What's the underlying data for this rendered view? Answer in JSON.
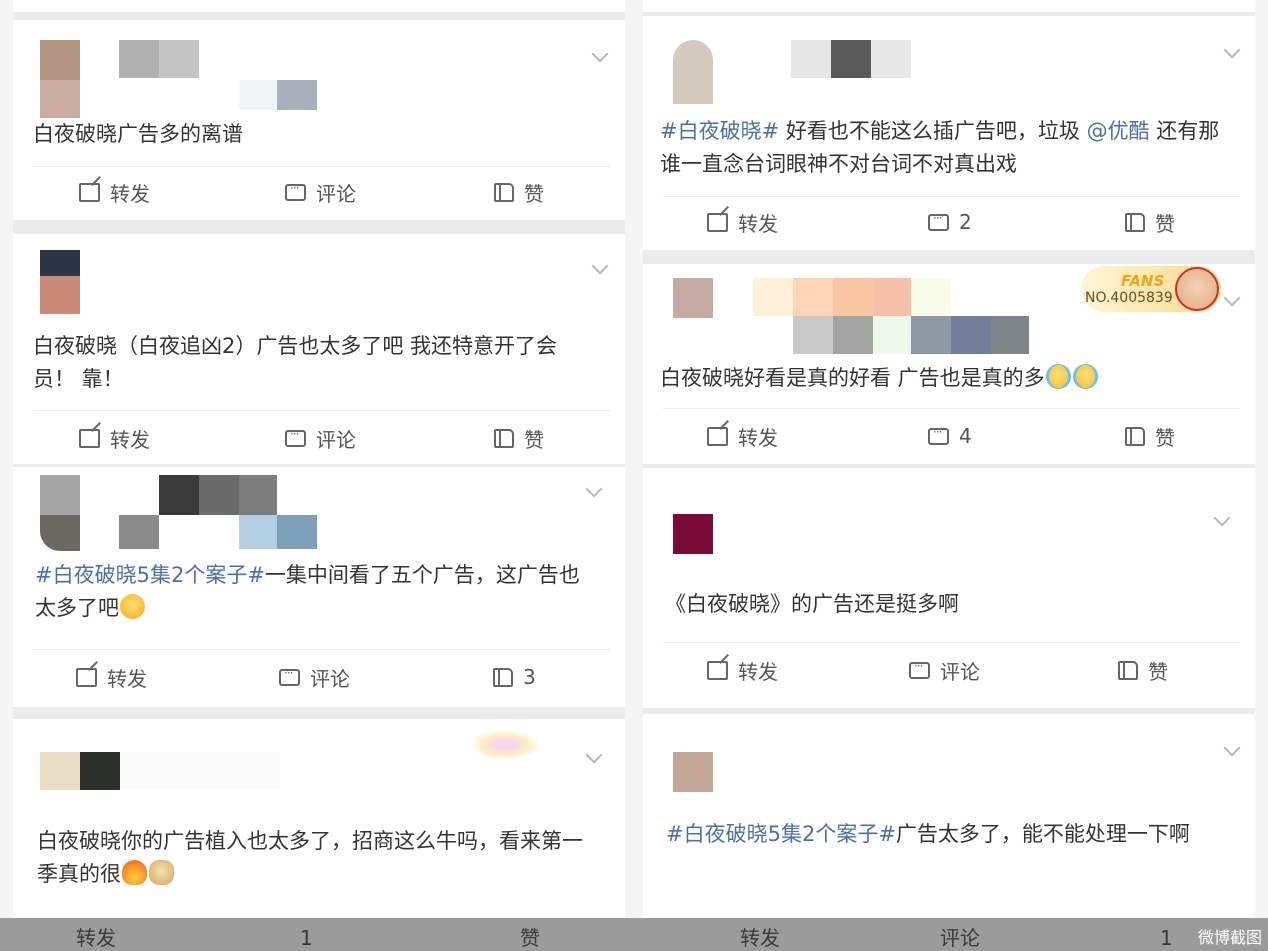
{
  "actions": {
    "repost": "转发",
    "comment": "评论",
    "like": "赞"
  },
  "posts_left": [
    {
      "text": "白夜破晓广告多的离谱",
      "repost": "转发",
      "comment": "评论",
      "like": "赞"
    },
    {
      "text": "白夜破晓（白夜追凶2）广告也太多了吧 我还特意开了会员！ 靠！",
      "repost": "转发",
      "comment": "评论",
      "like": "赞"
    },
    {
      "hashtag": "#白夜破晓5集2个案子#",
      "text": "一集中间看了五个广告，这广告也太多了吧",
      "emoji": "laughing-emoji",
      "repost": "转发",
      "comment": "评论",
      "like": "3"
    },
    {
      "text": "白夜破晓你的广告植入也太多了，招商这么牛吗，看来第一季真的很",
      "emoji": [
        "fire-emoji",
        "doge-emoji"
      ],
      "repost": "转发",
      "comment": "1",
      "like": "赞"
    }
  ],
  "posts_right": [
    {
      "hashtag": "#白夜破晓#",
      "text_a": " 好看也不能这么插广告吧，垃圾 ",
      "mention": "@优酷",
      "text_b": " 还有那谁一直念台词眼神不对台词不对真出戏",
      "repost": "转发",
      "comment": "2",
      "like": "赞"
    },
    {
      "text": "白夜破晓好看是真的好看 广告也是真的多",
      "emoji": [
        "crying-emoji",
        "crying-emoji"
      ],
      "repost": "转发",
      "comment": "4",
      "like": "赞",
      "fans_badge": {
        "label": "FANS",
        "number": "NO.4005839"
      }
    },
    {
      "text": "《白夜破晓》的广告还是挺多啊",
      "repost": "转发",
      "comment": "评论",
      "like": "赞"
    },
    {
      "hashtag": "#白夜破晓5集2个案子#",
      "text": "广告太多了，能不能处理一下啊",
      "repost": "转发",
      "comment": "评论",
      "like": "1"
    }
  ],
  "watermark": "微博截图",
  "colors": {
    "hashtag": "#4c6fa8",
    "text": "#333333",
    "separator": "#ebebeb",
    "watermark_bar": "#9b9b9b"
  }
}
